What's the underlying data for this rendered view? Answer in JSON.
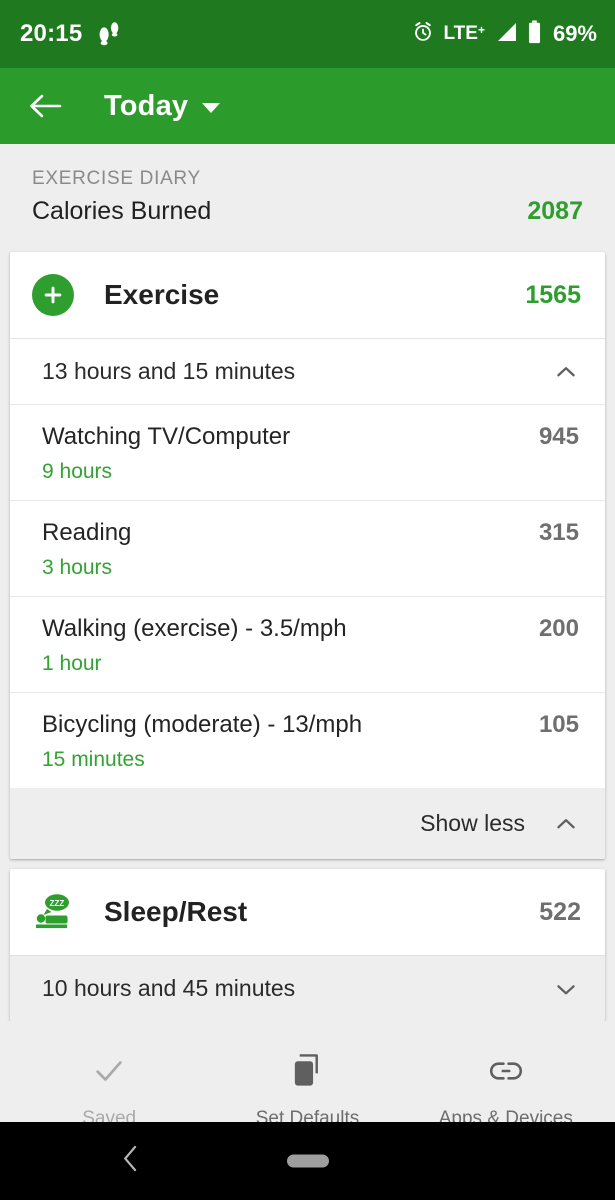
{
  "status_bar": {
    "time": "20:15",
    "steps_icon": "footprints-icon",
    "alarm_icon": "alarm-clock-icon",
    "network": "LTE",
    "network_sup": "+",
    "signal_icon": "signal-bars-icon",
    "battery_icon": "battery-icon",
    "battery_pct": "69%",
    "background_color": "#1f7a1f"
  },
  "app_bar": {
    "back_icon": "arrow-left-icon",
    "title": "Today",
    "dropdown_icon": "caret-down-icon",
    "background_color": "#2b9b2b"
  },
  "diary": {
    "kicker": "EXERCISE DIARY",
    "label": "Calories Burned",
    "value": "2087",
    "value_color": "#2e9e2e"
  },
  "exercise_card": {
    "add_icon": "plus-icon",
    "title": "Exercise",
    "total": "1565",
    "total_color": "#2e9e2e",
    "summary": "13 hours and 15 minutes",
    "summary_chevron": "chevron-up-icon",
    "entries": [
      {
        "name": "Watching TV/Computer",
        "calories": "945",
        "duration": "9 hours"
      },
      {
        "name": "Reading",
        "calories": "315",
        "duration": "3 hours"
      },
      {
        "name": "Walking (exercise) - 3.5/mph",
        "calories": "200",
        "duration": "1 hour"
      },
      {
        "name": "Bicycling (moderate) - 13/mph",
        "calories": "105",
        "duration": "15 minutes"
      }
    ],
    "show_less_label": "Show less",
    "show_less_chevron": "chevron-up-icon"
  },
  "sleep_card": {
    "icon": "sleeping-person-icon",
    "title": "Sleep/Rest",
    "total": "522",
    "total_color": "#6f6f6f",
    "summary": "10 hours and 45 minutes",
    "summary_chevron": "chevron-down-icon"
  },
  "action_bar": {
    "items": [
      {
        "label": "Saved",
        "icon": "check-icon",
        "state": "disabled"
      },
      {
        "label": "Set Defaults",
        "icon": "copy-icon",
        "state": "enabled"
      },
      {
        "label": "Apps & Devices",
        "icon": "link-icon",
        "state": "enabled"
      }
    ]
  },
  "nav_bar": {
    "back_icon": "nav-back-chevron-icon",
    "home_icon": "nav-home-pill"
  }
}
